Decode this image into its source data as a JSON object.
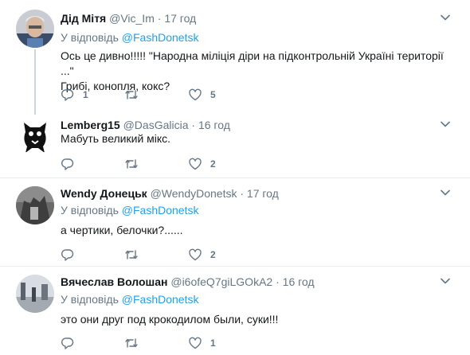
{
  "reply_prefix": "У відповідь",
  "tweets": [
    {
      "name": "Дід Мітя",
      "handle": "@Vic_Im",
      "time": "17 год",
      "reply_to": "@FashDonetsk",
      "text_lines": [
        "Ось це дивно!!!!! \"Народна міліція діри на підконтрольній Україні території ...\"",
        "Грибі, конопля, кокс?"
      ],
      "replies": "1",
      "retweets": "",
      "likes": "5"
    },
    {
      "name": "Lemberg15",
      "handle": "@DasGalicia",
      "time": "16 год",
      "text_lines": [
        "Мабуть великий мікс."
      ],
      "replies": "",
      "retweets": "",
      "likes": "2"
    },
    {
      "name": "Wendy Донецьк",
      "handle": "@WendyDonetsk",
      "time": "17 год",
      "reply_to": "@FashDonetsk",
      "text_lines": [
        "а чертики, белочки?......"
      ],
      "replies": "",
      "retweets": "",
      "likes": "2"
    },
    {
      "name": "Вячеслав Волошан",
      "handle": "@i6ofeQ7giLGOkA2",
      "time": "16 год",
      "reply_to": "@FashDonetsk",
      "text_lines": [
        "это они друг под крокодилом были, суки!!!"
      ],
      "replies": "",
      "retweets": "",
      "likes": "1"
    }
  ],
  "colors": {
    "accent": "#1da1f2",
    "secondary_text": "#657786",
    "border": "#e6ecf0",
    "thread_line": "#ccd6dd"
  },
  "icons": [
    "reply-icon",
    "retweet-icon",
    "like-icon",
    "chevron-down-icon"
  ]
}
